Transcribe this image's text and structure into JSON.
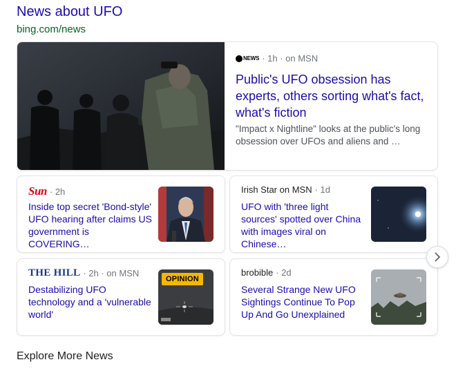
{
  "header": {
    "title": "News about UFO",
    "url": "bing.com/news"
  },
  "hero": {
    "source_logo": "NEWS",
    "meta": "· 1h · on MSN",
    "headline": "Public's UFO obsession has experts, others sorting what's fact, what's fiction",
    "snippet": "\"Impact x Nightline\" looks at the public's long obsession over UFOs and aliens and …"
  },
  "cards": [
    {
      "source": "Sun",
      "meta": "· 2h",
      "headline": "Inside top secret 'Bond-style' UFO hearing after claims US government is COVERING…"
    },
    {
      "source": "Irish Star on MSN",
      "meta": "· 1d",
      "headline": "UFO with 'three light sources' spotted over China with images viral on Chinese…"
    },
    {
      "source": "THE HILL",
      "meta": "· 2h · on MSN",
      "headline": "Destabilizing UFO technology and a 'vulnerable world'",
      "badge": "OPINION"
    },
    {
      "source": "brobible",
      "meta": "· 2d",
      "headline": "Several Strange New UFO Sightings Continue To Pop Up And Go Unexplained"
    }
  ],
  "footer": {
    "explore": "Explore More News"
  },
  "colors": {
    "link": "#1a0dab",
    "url": "#006621",
    "badge": "#f5b800"
  }
}
